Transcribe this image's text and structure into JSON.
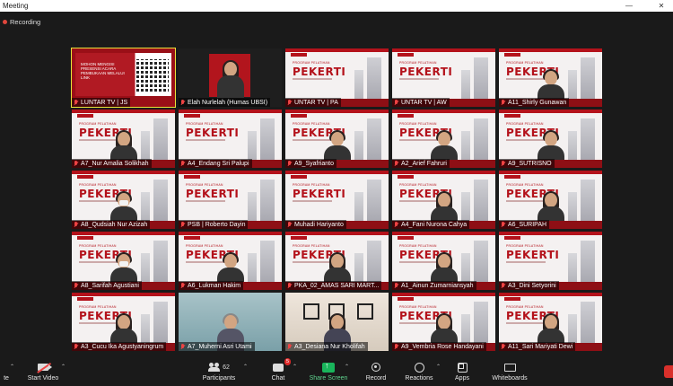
{
  "window": {
    "title": "Meeting",
    "min": "—",
    "close": "✕"
  },
  "recording": {
    "label": "Recording"
  },
  "tiles": [
    {
      "name": "LUNTAR TV | JS",
      "kind": "poster",
      "active": true,
      "muted": true
    },
    {
      "name": "Elah Nurlelah (Humas UBSI)",
      "kind": "darkred",
      "muted": true
    },
    {
      "name": "UNTAR TV | PA",
      "kind": "slide",
      "muted": true
    },
    {
      "name": "UNTAR TV | AW",
      "kind": "slide",
      "muted": true
    },
    {
      "name": "A11_Shirly Gunawan",
      "kind": "slide-person",
      "muted": true
    },
    {
      "name": "A7_Nur Amalia Solikhah",
      "kind": "slide-person",
      "person": "hijab",
      "muted": true
    },
    {
      "name": "A4_Endang Sri Palupi",
      "kind": "slide",
      "muted": true
    },
    {
      "name": "A9_Syafrianto",
      "kind": "slide-person",
      "muted": true
    },
    {
      "name": "A2_Arief Fahruri",
      "kind": "slide-person",
      "muted": true
    },
    {
      "name": "A9_SUTRISNO",
      "kind": "slide-person",
      "muted": true
    },
    {
      "name": "A8_Qudsiah Nur Azizah",
      "kind": "slide-person",
      "person": "mask",
      "muted": true
    },
    {
      "name": "PSB | Roberto Dayin",
      "kind": "slide",
      "muted": true
    },
    {
      "name": "Muhadi Hariyanto",
      "kind": "slide",
      "muted": true
    },
    {
      "name": "A4_Fani Nurona Cahya",
      "kind": "slide-person",
      "person": "hijab",
      "muted": true
    },
    {
      "name": "A6_SURIPAH",
      "kind": "slide-person",
      "person": "hijab",
      "muted": true
    },
    {
      "name": "A8_Sarifah Agustiani",
      "kind": "slide-person",
      "person": "mask",
      "muted": true
    },
    {
      "name": "A6_Lukman Hakim",
      "kind": "slide-person",
      "muted": true
    },
    {
      "name": "PKA_02_AMAS SARI MART...",
      "kind": "slide-person",
      "person": "hijab",
      "muted": true
    },
    {
      "name": "A1_Ainun Zumarniansyah",
      "kind": "slide-person",
      "person": "hijab",
      "muted": true
    },
    {
      "name": "A3_Dini Setyorini",
      "kind": "slide",
      "muted": true
    },
    {
      "name": "A3_Cucu Ika Agustyaningrum",
      "kind": "slide-person",
      "person": "hijab",
      "muted": true
    },
    {
      "name": "A7_Muherni Asri Utami",
      "kind": "greenroom",
      "muted": true
    },
    {
      "name": "A3_Desiana Nur Kholifah",
      "kind": "room",
      "muted": true
    },
    {
      "name": "A9_Vembria Rose Handayani",
      "kind": "slide-person",
      "person": "hijab",
      "muted": true
    },
    {
      "name": "A11_Sari Mariyati Dewi",
      "kind": "slide-person",
      "person": "hijab",
      "muted": true
    }
  ],
  "slide_text": {
    "program": "PROGRAM PELATIHAN",
    "title": "PEKERTI",
    "poster_line": "MOHON MENGISI PRESENSI ACARA PEMBUKAAN MELALUI LINK",
    "poster_big": "ACARA PEMBUKAAN"
  },
  "toolbar": {
    "mute_label": "te",
    "video_label": "Start Video",
    "participants_label": "Participants",
    "participants_count": "62",
    "chat_label": "Chat",
    "chat_badge": "5",
    "share_label": "Share Screen",
    "record_label": "Record",
    "reactions_label": "Reactions",
    "apps_label": "Apps",
    "whiteboards_label": "Whiteboards"
  }
}
